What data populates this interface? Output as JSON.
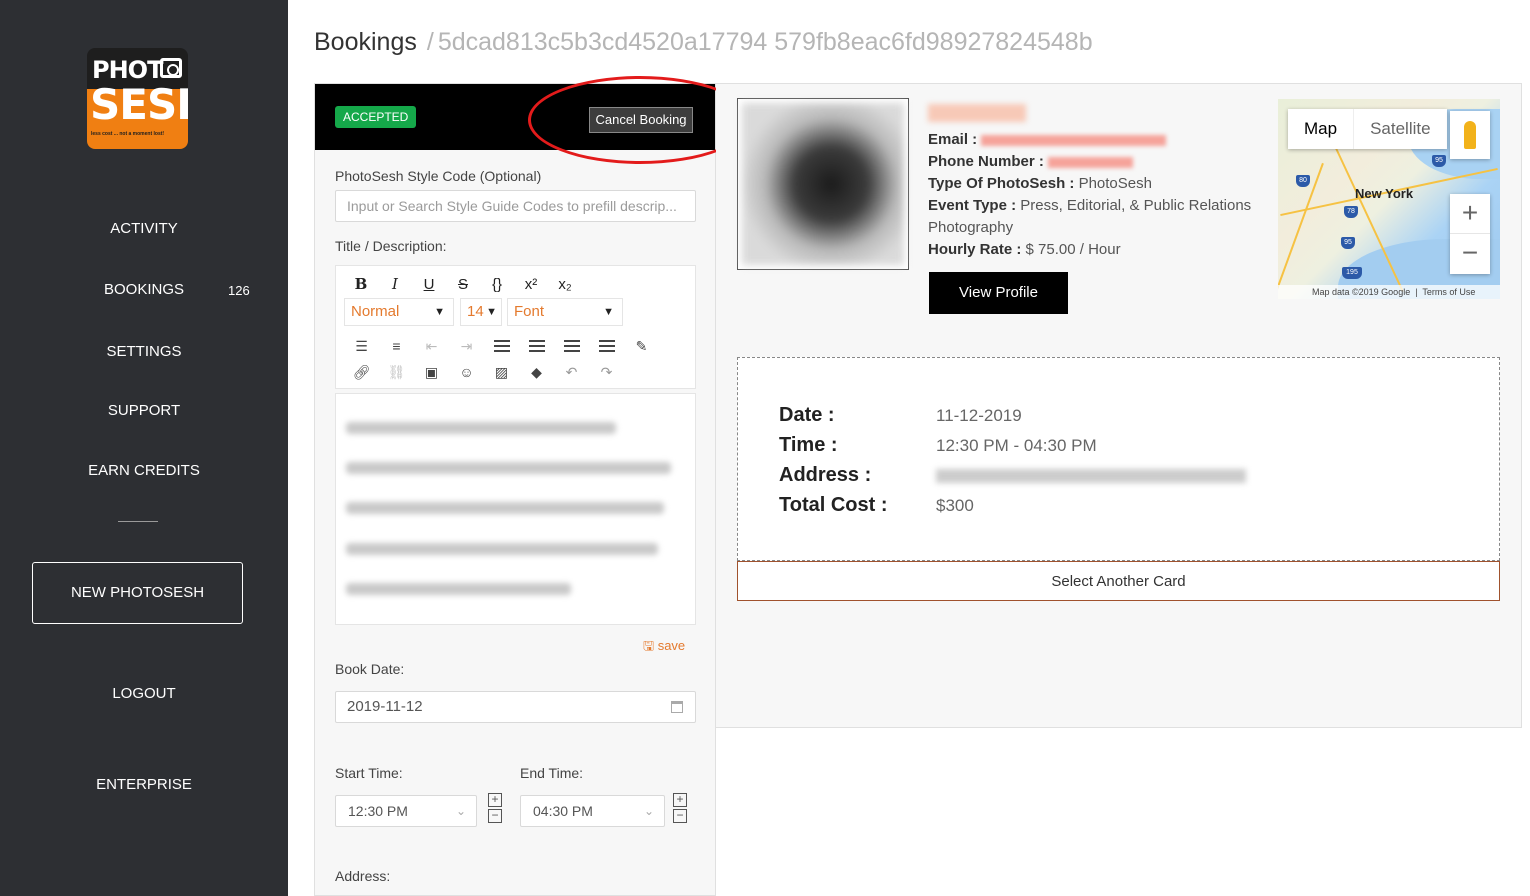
{
  "sidebar": {
    "logo": {
      "line1": "PHOT",
      "line2": "SESH",
      "tagline": "less cost ... not a moment lost!"
    },
    "nav": [
      {
        "label": "ACTIVITY"
      },
      {
        "label": "BOOKINGS",
        "badge": "126"
      },
      {
        "label": "SETTINGS"
      },
      {
        "label": "SUPPORT"
      },
      {
        "label": "EARN CREDITS"
      }
    ],
    "new_button": "NEW PHOTOSESH",
    "logout": "LOGOUT",
    "enterprise": "ENTERPRISE"
  },
  "header": {
    "title": "Bookings",
    "separator": "/",
    "booking_id": "5dcad813c5b3cd4520a17794 579fb8eac6fd98927824548b"
  },
  "booking": {
    "status": "ACCEPTED",
    "cancel_label": "Cancel Booking",
    "style_code_label": "PhotoSesh Style Code (Optional)",
    "style_code_placeholder": "Input or Search Style Guide Codes to prefill descrip...",
    "title_label": "Title / Description:",
    "editor": {
      "style_select": "Normal",
      "size_select": "14",
      "font_select": "Font"
    },
    "save_label": "save",
    "book_date_label": "Book Date:",
    "book_date_value": "2019-11-12",
    "start_time_label": "Start Time:",
    "start_time_value": "12:30 PM",
    "end_time_label": "End Time:",
    "end_time_value": "04:30 PM",
    "address_label": "Address:"
  },
  "profile": {
    "email_label": "Email :",
    "phone_label": "Phone Number :",
    "type_label": "Type Of PhotoSesh :",
    "type_value": "PhotoSesh",
    "event_label": "Event Type :",
    "event_value": "Press, Editorial, & Public Relations",
    "event_value_2": "Photography",
    "rate_label": "Hourly Rate :",
    "rate_value": "$ 75.00 / Hour",
    "view_profile": "View Profile"
  },
  "map": {
    "tab_map": "Map",
    "tab_satellite": "Satellite",
    "city": "New York",
    "attribution": "Map data ©2019 Google",
    "terms": "Terms of Use",
    "zoom_in": "+",
    "zoom_out": "−",
    "shields": [
      "95",
      "80",
      "78",
      "95",
      "195"
    ]
  },
  "details": {
    "date_label": "Date :",
    "date_value": "11-12-2019",
    "time_label": "Time :",
    "time_value": "12:30 PM - 04:30 PM",
    "address_label": "Address :",
    "cost_label": "Total Cost :",
    "cost_value": "$300"
  },
  "select_card": "Select Another Card",
  "colors": {
    "sidebar_bg": "#2d2f33",
    "accent_orange": "#e47a2e",
    "accepted_green": "#15a84a",
    "annotation_red": "#e31b1b"
  }
}
